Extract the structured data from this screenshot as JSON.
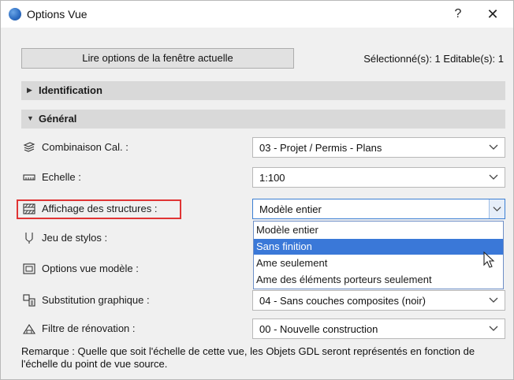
{
  "window": {
    "title": "Options Vue",
    "help_label": "?",
    "close_label": "✕"
  },
  "toolbar": {
    "read_button_label": "Lire options de la fenêtre actuelle",
    "selection_info": "Sélectionné(s): 1 Editable(s): 1"
  },
  "sections": {
    "identification": "Identification",
    "general": "Général"
  },
  "rows": {
    "combinaison": {
      "label": "Combinaison Cal. :",
      "value": "03 - Projet / Permis - Plans",
      "icon": "layers-icon"
    },
    "echelle": {
      "label": "Echelle :",
      "value": "1:100",
      "icon": "ruler-icon"
    },
    "affichage": {
      "label": "Affichage des structures :",
      "value": "Modèle entier",
      "icon": "structure-icon"
    },
    "stylos": {
      "label": "Jeu de stylos :",
      "icon": "pen-icon"
    },
    "options_vue": {
      "label": "Options vue modèle :",
      "icon": "model-view-icon"
    },
    "substitution": {
      "label": "Substitution graphique :",
      "value": "04 - Sans couches composites (noir)",
      "icon": "graphic-override-icon"
    },
    "renovation": {
      "label": "Filtre de rénovation :",
      "value": "00 - Nouvelle construction",
      "icon": "renovation-icon"
    }
  },
  "dropdown": {
    "items": [
      "Modèle entier",
      "Sans finition",
      "Ame seulement",
      "Ame des éléments porteurs seulement"
    ],
    "highlighted": "Sans finition"
  },
  "remark": "Remarque : Quelle que soit l'échelle de cette vue, les Objets GDL seront représentés en fonction de l'échelle du point de vue source.",
  "colors": {
    "highlight": "#3a78d8",
    "annotation_box": "#e03434"
  }
}
